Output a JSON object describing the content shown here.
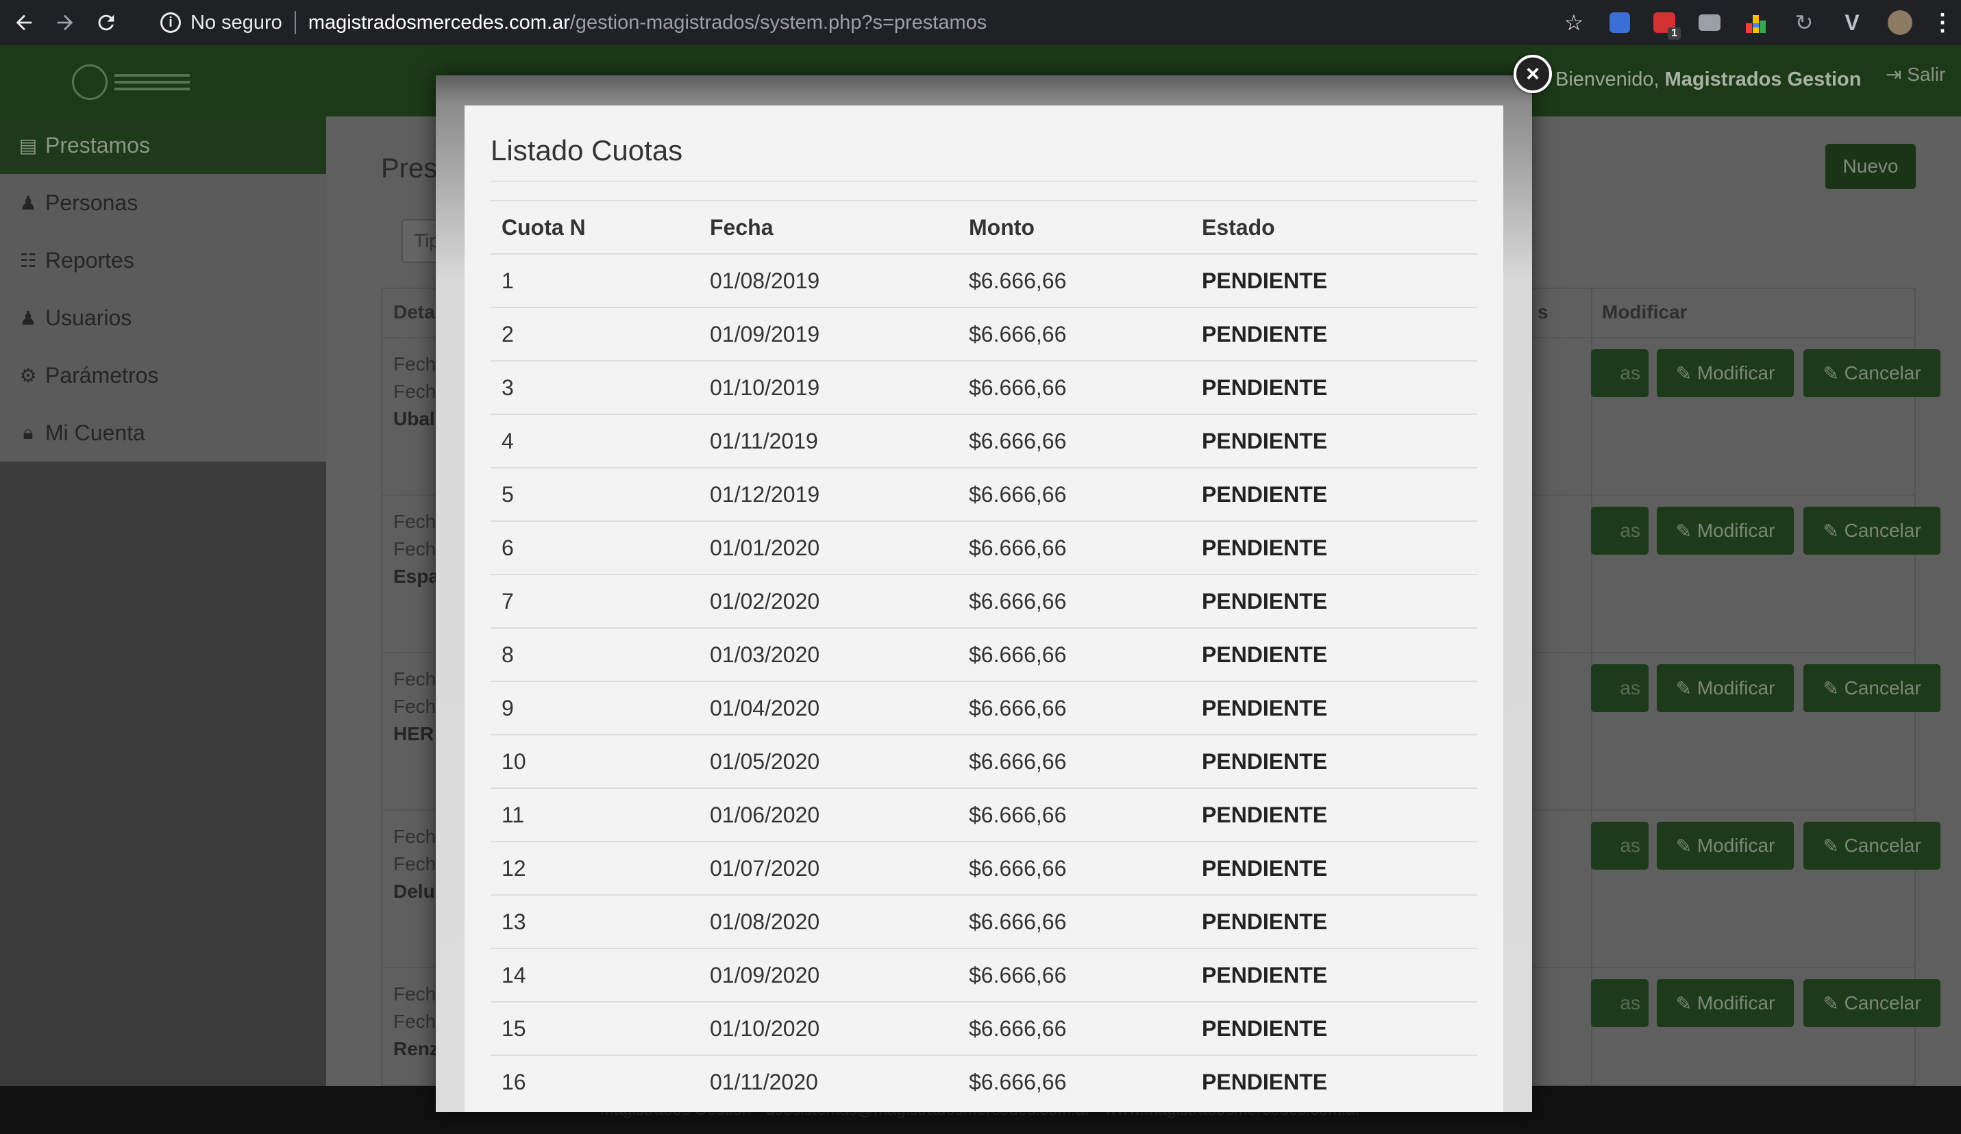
{
  "browser": {
    "security_label": "No seguro",
    "url_host": "magistradosmercedes.com.ar",
    "url_path": "/gestion-magistrados/system.php?s=prestamos",
    "extension_badge": "1"
  },
  "header": {
    "welcome_prefix": "Bienvenido,",
    "welcome_user": "Magistrados Gestion",
    "logout_label": "Salir"
  },
  "sidebar": {
    "items": [
      {
        "label": "Prestamos",
        "icon": "file-icon",
        "active": true
      },
      {
        "label": "Personas",
        "icon": "users-icon"
      },
      {
        "label": "Reportes",
        "icon": "list-icon"
      },
      {
        "label": "Usuarios",
        "icon": "users-icon"
      },
      {
        "label": "Parámetros",
        "icon": "gears-icon"
      },
      {
        "label": "Mi Cuenta",
        "icon": "lock-icon"
      }
    ]
  },
  "content": {
    "heading": "Pres",
    "filter_placeholder": "Tip",
    "new_button": "Nuevo",
    "columns": {
      "detail": "Deta",
      "cuotas": "s",
      "modify": "Modificar"
    },
    "rows": [
      {
        "line1": "Fech",
        "line2": "Fech",
        "name": "Ubal",
        "cuotas_btn": "as",
        "modify_btn": "Modificar",
        "cancel_btn": "Cancelar"
      },
      {
        "line1": "Fech",
        "line2": "Fech",
        "name": "Espa",
        "cuotas_btn": "as",
        "modify_btn": "Modificar",
        "cancel_btn": "Cancelar"
      },
      {
        "line1": "Fech",
        "line2": "Fech",
        "name": "HER",
        "cuotas_btn": "as",
        "modify_btn": "Modificar",
        "cancel_btn": "Cancelar"
      },
      {
        "line1": "Fech",
        "line2": "Fech",
        "name": "Delu",
        "cuotas_btn": "as",
        "modify_btn": "Modificar",
        "cancel_btn": "Cancelar"
      },
      {
        "line1": "Fech",
        "line2": "Fech",
        "name": "Renz",
        "cuotas_btn": "as",
        "modify_btn": "Modificar",
        "cancel_btn": "Cancelar"
      }
    ]
  },
  "footer": {
    "text": "Magistrados Gestion · usosistemas@magistradosmercedes.com.ar · www.magistradosmercedes.com.ar"
  },
  "modal": {
    "title": "Listado Cuotas",
    "close_label": "×",
    "headers": [
      "Cuota N",
      "Fecha",
      "Monto",
      "Estado"
    ],
    "rows": [
      [
        "1",
        "01/08/2019",
        "$6.666,66",
        "PENDIENTE"
      ],
      [
        "2",
        "01/09/2019",
        "$6.666,66",
        "PENDIENTE"
      ],
      [
        "3",
        "01/10/2019",
        "$6.666,66",
        "PENDIENTE"
      ],
      [
        "4",
        "01/11/2019",
        "$6.666,66",
        "PENDIENTE"
      ],
      [
        "5",
        "01/12/2019",
        "$6.666,66",
        "PENDIENTE"
      ],
      [
        "6",
        "01/01/2020",
        "$6.666,66",
        "PENDIENTE"
      ],
      [
        "7",
        "01/02/2020",
        "$6.666,66",
        "PENDIENTE"
      ],
      [
        "8",
        "01/03/2020",
        "$6.666,66",
        "PENDIENTE"
      ],
      [
        "9",
        "01/04/2020",
        "$6.666,66",
        "PENDIENTE"
      ],
      [
        "10",
        "01/05/2020",
        "$6.666,66",
        "PENDIENTE"
      ],
      [
        "11",
        "01/06/2020",
        "$6.666,66",
        "PENDIENTE"
      ],
      [
        "12",
        "01/07/2020",
        "$6.666,66",
        "PENDIENTE"
      ],
      [
        "13",
        "01/08/2020",
        "$6.666,66",
        "PENDIENTE"
      ],
      [
        "14",
        "01/09/2020",
        "$6.666,66",
        "PENDIENTE"
      ],
      [
        "15",
        "01/10/2020",
        "$6.666,66",
        "PENDIENTE"
      ],
      [
        "16",
        "01/11/2020",
        "$6.666,66",
        "PENDIENTE"
      ]
    ]
  },
  "colors": {
    "header_green": "#1c3a18",
    "sidebar_active": "#1e3a1a",
    "button_green": "#1d3a1b",
    "overlay": "#3a3a3a"
  }
}
